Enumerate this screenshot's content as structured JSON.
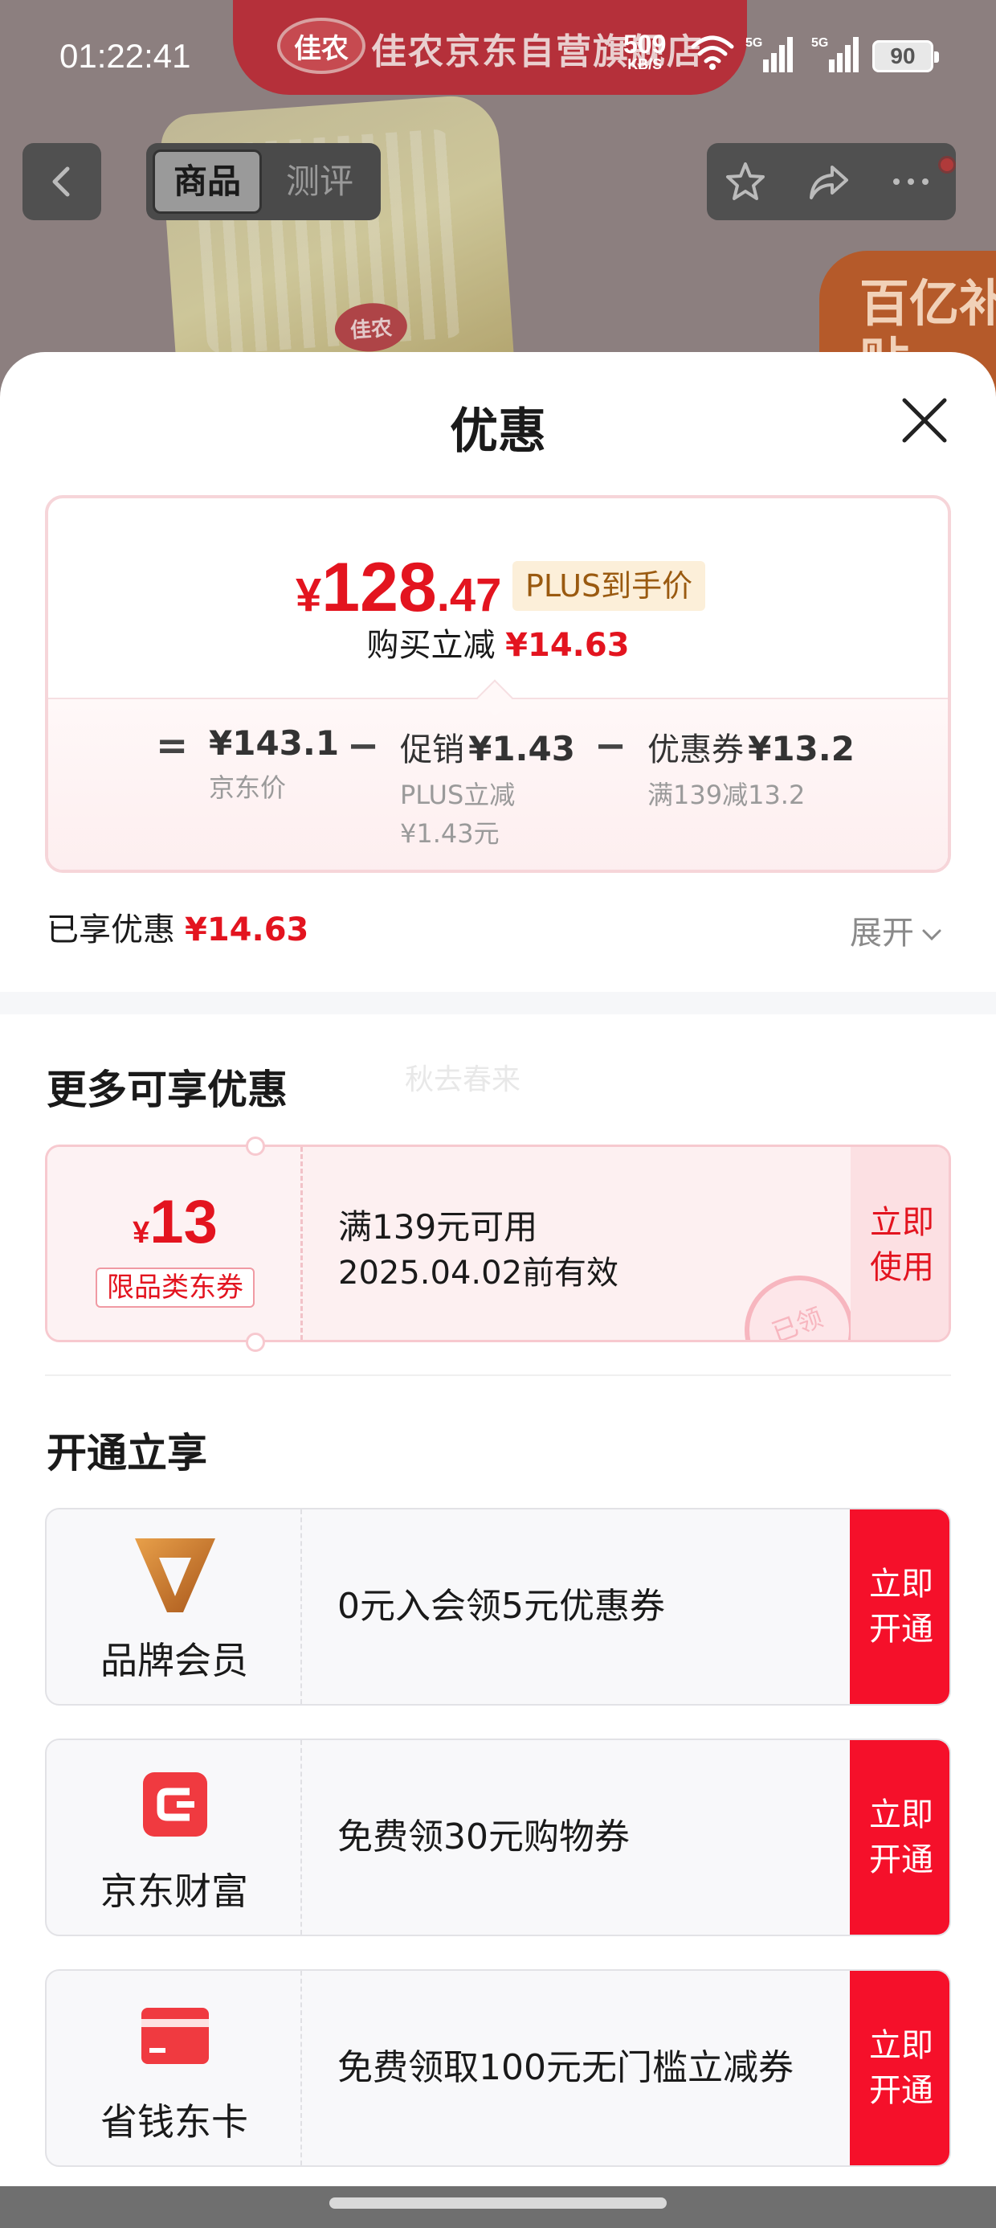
{
  "status_bar": {
    "time": "01:22:41",
    "net_speed": "509",
    "net_unit": "KB/S",
    "sig1_label": "5G",
    "sig2_label": "5G",
    "battery": "90"
  },
  "background": {
    "store_logo": "佳农",
    "store_name": "佳农京东自营旗舰店",
    "badge_text": "百亿补贴",
    "product_logo": "佳农"
  },
  "nav": {
    "tabs": [
      "商品",
      "测评"
    ]
  },
  "sheet": {
    "title": "优惠",
    "price": {
      "currency": "¥",
      "integer": "128",
      "decimal": ".47",
      "tag": "PLUS到手价",
      "reduce_label": "购买立减",
      "reduce_value": "¥14.63"
    },
    "breakdown": {
      "equals": "=",
      "minus": "−",
      "base": {
        "value": "¥143.1",
        "label": "京东价"
      },
      "promo": {
        "label": "促销",
        "value": "¥1.43",
        "sub1": "PLUS立减",
        "sub2": "¥1.43元"
      },
      "coupon": {
        "label": "优惠券",
        "value": "¥13.2",
        "sub": "满139减13.2"
      }
    },
    "enjoyed": {
      "label": "已享优惠",
      "value": "¥14.63"
    },
    "expand_label": "展开"
  },
  "more": {
    "title": "更多可享优惠",
    "watermark": "秋去春来",
    "coupon": {
      "currency": "¥",
      "amount": "13",
      "tag": "限品类东券",
      "condition": "满139元可用",
      "valid": "2025.04.02前有效",
      "stamp": "已领",
      "button": "立即使用"
    }
  },
  "open": {
    "title": "开通立享",
    "offers": [
      {
        "name": "品牌会员",
        "desc": "0元入会领5元优惠券",
        "button": "立即开通",
        "icon": "brand-v-icon"
      },
      {
        "name": "京东财富",
        "desc": "免费领30元购物券",
        "button": "立即开通",
        "icon": "jd-wealth-icon"
      },
      {
        "name": "省钱东卡",
        "desc": "免费领取100元无门槛立减券",
        "button": "立即开通",
        "icon": "card-icon"
      }
    ]
  },
  "colors": {
    "accent_red": "#e3141f",
    "button_red": "#f5102a",
    "plus_gold": "#9a5a10"
  }
}
